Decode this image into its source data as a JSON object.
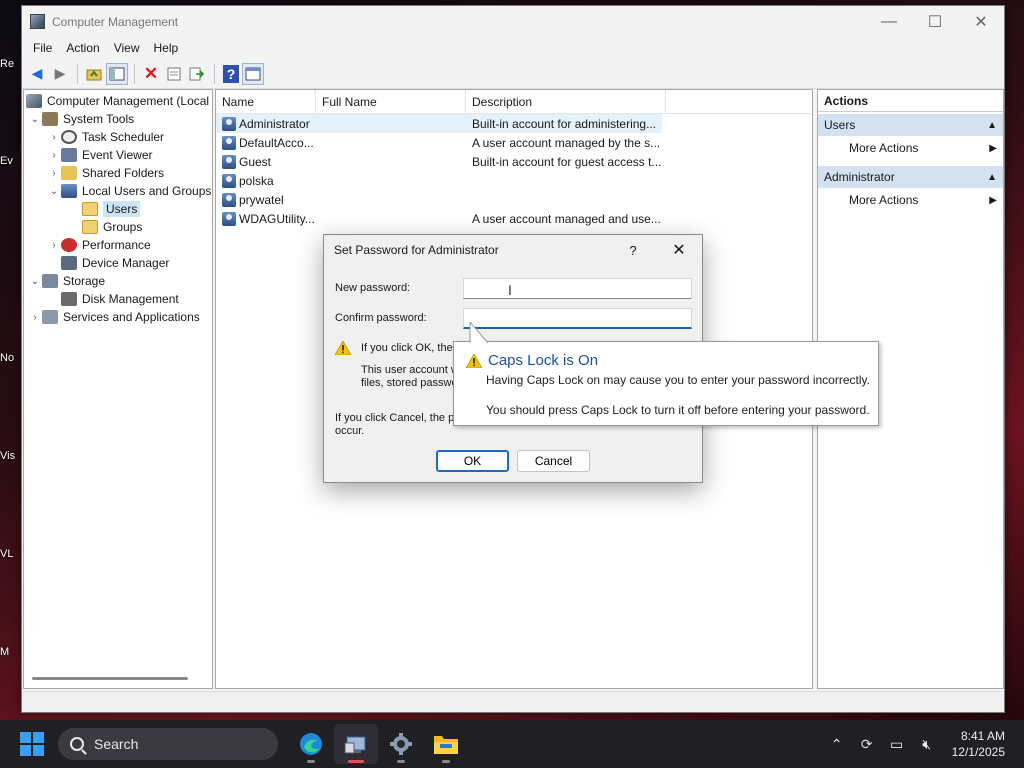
{
  "window": {
    "title": "Computer Management",
    "controls": {
      "minimize": "—",
      "maximize": "☐",
      "close": "✕"
    }
  },
  "menu": [
    "File",
    "Action",
    "View",
    "Help"
  ],
  "tree": [
    {
      "label": "Computer Management (Local",
      "icon": "computer-management-icon",
      "arrow": ""
    },
    {
      "label": "System Tools",
      "icon": "system-tools-icon",
      "arrow": "⌄"
    },
    {
      "label": "Task Scheduler",
      "icon": "task-scheduler-icon",
      "arrow": "›"
    },
    {
      "label": "Event Viewer",
      "icon": "event-viewer-icon",
      "arrow": "›"
    },
    {
      "label": "Shared Folders",
      "icon": "shared-folders-icon",
      "arrow": "›"
    },
    {
      "label": "Local Users and Groups",
      "icon": "local-users-icon",
      "arrow": "⌄"
    },
    {
      "label": "Users",
      "icon": "folder-icon",
      "arrow": ""
    },
    {
      "label": "Groups",
      "icon": "folder-icon",
      "arrow": ""
    },
    {
      "label": "Performance",
      "icon": "performance-icon",
      "arrow": "›"
    },
    {
      "label": "Device Manager",
      "icon": "device-manager-icon",
      "arrow": ""
    },
    {
      "label": "Storage",
      "icon": "storage-icon",
      "arrow": "⌄"
    },
    {
      "label": "Disk Management",
      "icon": "disk-management-icon",
      "arrow": ""
    },
    {
      "label": "Services and Applications",
      "icon": "services-icon",
      "arrow": "›"
    }
  ],
  "list": {
    "columns": [
      "Name",
      "Full Name",
      "Description"
    ],
    "rows": [
      {
        "name": "Administrator",
        "full": "",
        "desc": "Built-in account for administering..."
      },
      {
        "name": "DefaultAcco...",
        "full": "",
        "desc": "A user account managed by the s..."
      },
      {
        "name": "Guest",
        "full": "",
        "desc": "Built-in account for guest access t..."
      },
      {
        "name": "polska",
        "full": "",
        "desc": ""
      },
      {
        "name": "prywatel",
        "full": "",
        "desc": ""
      },
      {
        "name": "WDAGUtility...",
        "full": "",
        "desc": "A user account managed and use..."
      }
    ]
  },
  "actions": {
    "header": "Actions",
    "sections": [
      {
        "title": "Users",
        "items": [
          "More Actions"
        ]
      },
      {
        "title": "Administrator",
        "items": [
          "More Actions"
        ]
      }
    ]
  },
  "dialog": {
    "title": "Set Password for Administrator",
    "help": "?",
    "close": "✕",
    "new_password_label": "New password:",
    "confirm_password_label": "Confirm password:",
    "warn_line1": "If you click OK, the",
    "warn_line2": "This user account w",
    "warn_line3": "files, stored passwor",
    "cancel_line1": "If you click Cancel, the pa",
    "cancel_line2": "occur.",
    "ok": "OK",
    "cancel": "Cancel"
  },
  "balloon": {
    "title": "Caps Lock is On",
    "line1": "Having Caps Lock on may cause you to enter your password incorrectly.",
    "line2": "You should press Caps Lock to turn it off before entering your password."
  },
  "taskbar": {
    "search": "Search",
    "time": "8:41 AM",
    "date": "12/1/2025"
  },
  "desktop_fragments": [
    "Re",
    "Ev",
    "No",
    "Vis",
    "VL",
    "M"
  ],
  "colors": {
    "accent": "#1b5fb4",
    "selection": "#cce4f7",
    "actions_section": "#d3e1f1",
    "warning": "#f2c500"
  }
}
